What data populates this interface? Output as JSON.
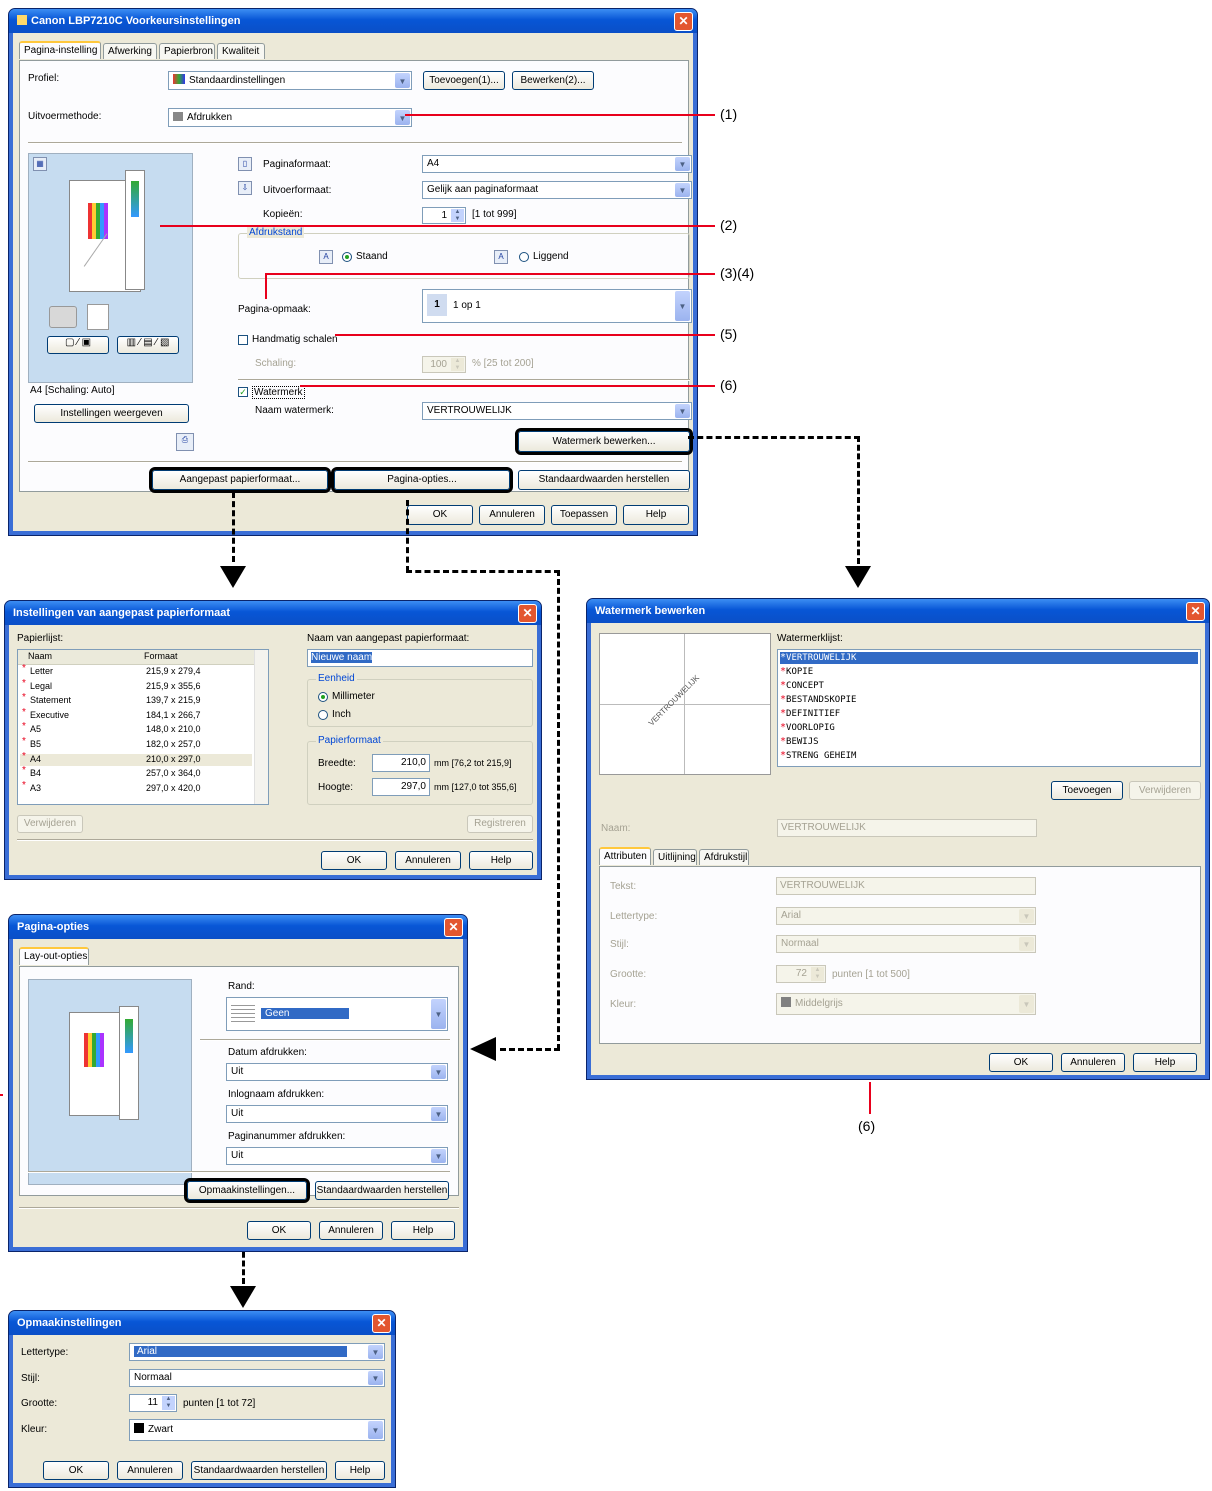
{
  "main": {
    "title": "Canon LBP7210C Voorkeursinstellingen",
    "tabs": [
      "Pagina-instelling",
      "Afwerking",
      "Papierbron",
      "Kwaliteit"
    ],
    "profile_label": "Profiel:",
    "profile_value": "Standaardinstellingen",
    "add_button": "Toevoegen(1)...",
    "edit_button": "Bewerken(2)...",
    "output_label": "Uitvoermethode:",
    "output_value": "Afdrukken",
    "page_size_label": "Paginaformaat:",
    "page_size_value": "A4",
    "output_size_label": "Uitvoerformaat:",
    "output_size_value": "Gelijk aan paginaformaat",
    "copies_label": "Kopieën:",
    "copies_value": "1",
    "copies_range": "[1 tot 999]",
    "orientation_group": "Afdrukstand",
    "portrait": "Staand",
    "landscape": "Liggend",
    "layout_label": "Pagina-opmaak:",
    "layout_value": "1 op 1",
    "manual_scale": "Handmatig schalen",
    "scaling_label": "Schaling:",
    "scaling_value": "100",
    "scaling_range": "% [25 tot 200]",
    "watermark_label": "Watermerk",
    "watermark_name_label": "Naam watermerk:",
    "watermark_name_value": "VERTROUWELIJK",
    "watermark_edit_button": "Watermerk bewerken...",
    "preview_status": "A4 [Schaling: Auto]",
    "view_settings_button": "Instellingen weergeven",
    "custom_paper_button": "Aangepast papierformaat...",
    "page_options_button": "Pagina-opties...",
    "restore_defaults_button": "Standaardwaarden herstellen",
    "ok": "OK",
    "cancel": "Annuleren",
    "apply": "Toepassen",
    "help": "Help"
  },
  "callouts": [
    "(1)",
    "(2)",
    "(3)(4)",
    "(5)",
    "(6)",
    "(6)"
  ],
  "custom_paper": {
    "title": "Instellingen van aangepast papierformaat",
    "list_label": "Papierlijst:",
    "col_name": "Naam",
    "col_size": "Formaat",
    "rows": [
      {
        "name": "Letter",
        "size": "215,9 x 279,4"
      },
      {
        "name": "Legal",
        "size": "215,9 x 355,6"
      },
      {
        "name": "Statement",
        "size": "139,7 x 215,9"
      },
      {
        "name": "Executive",
        "size": "184,1 x 266,7"
      },
      {
        "name": "A5",
        "size": "148,0 x 210,0"
      },
      {
        "name": "B5",
        "size": "182,0 x 257,0"
      },
      {
        "name": "A4",
        "size": "210,0 x 297,0"
      },
      {
        "name": "B4",
        "size": "257,0 x 364,0"
      },
      {
        "name": "A3",
        "size": "297,0 x 420,0"
      }
    ],
    "name_label": "Naam van aangepast papierformaat:",
    "name_value": "Nieuwe naam",
    "unit_group": "Eenheid",
    "unit_mm": "Millimeter",
    "unit_inch": "Inch",
    "size_group": "Papierformaat",
    "width_label": "Breedte:",
    "width_value": "210,0",
    "width_range": "mm [76,2 tot 215,9]",
    "height_label": "Hoogte:",
    "height_value": "297,0",
    "height_range": "mm [127,0 tot 355,6]",
    "delete_button": "Verwijderen",
    "register_button": "Registreren",
    "ok": "OK",
    "cancel": "Annuleren",
    "help": "Help"
  },
  "watermark": {
    "title": "Watermerk bewerken",
    "list_label": "Watermerklijst:",
    "items": [
      "VERTROUWELIJK",
      "KOPIE",
      "CONCEPT",
      "BESTANDSKOPIE",
      "DEFINITIEF",
      "VOORLOPIG",
      "BEWIJS",
      "STRENG GEHEIM"
    ],
    "preview_text": "VERTROUWELIJK",
    "add_button": "Toevoegen",
    "delete_button": "Verwijderen",
    "name_label": "Naam:",
    "name_value": "VERTROUWELIJK",
    "tabs": [
      "Attributen",
      "Uitlijning",
      "Afdrukstijl"
    ],
    "text_label": "Tekst:",
    "text_value": "VERTROUWELIJK",
    "font_label": "Lettertype:",
    "font_value": "Arial",
    "style_label": "Stijl:",
    "style_value": "Normaal",
    "size_label": "Grootte:",
    "size_value": "72",
    "size_range": "punten [1 tot 500]",
    "color_label": "Kleur:",
    "color_value": "Middelgrijs",
    "ok": "OK",
    "cancel": "Annuleren",
    "help": "Help"
  },
  "page_options": {
    "title": "Pagina-opties",
    "tab": "Lay-out-opties",
    "border_label": "Rand:",
    "border_value": "Geen",
    "date_label": "Datum afdrukken:",
    "date_value": "Uit",
    "user_label": "Inlognaam afdrukken:",
    "user_value": "Uit",
    "pagenum_label": "Paginanummer afdrukken:",
    "pagenum_value": "Uit",
    "format_button": "Opmaakinstellingen...",
    "restore_button": "Standaardwaarden herstellen",
    "ok": "OK",
    "cancel": "Annuleren",
    "help": "Help"
  },
  "format": {
    "title": "Opmaakinstellingen",
    "font_label": "Lettertype:",
    "font_value": "Arial",
    "style_label": "Stijl:",
    "style_value": "Normaal",
    "size_label": "Grootte:",
    "size_value": "11",
    "size_range": "punten [1 tot 72]",
    "color_label": "Kleur:",
    "color_value": "Zwart",
    "ok": "OK",
    "cancel": "Annuleren",
    "restore_button": "Standaardwaarden herstellen",
    "help": "Help"
  },
  "colors": {
    "callout_line": "#e8001c",
    "title_bar": "#0856d6",
    "dialog_bg": "#ece9d8"
  }
}
